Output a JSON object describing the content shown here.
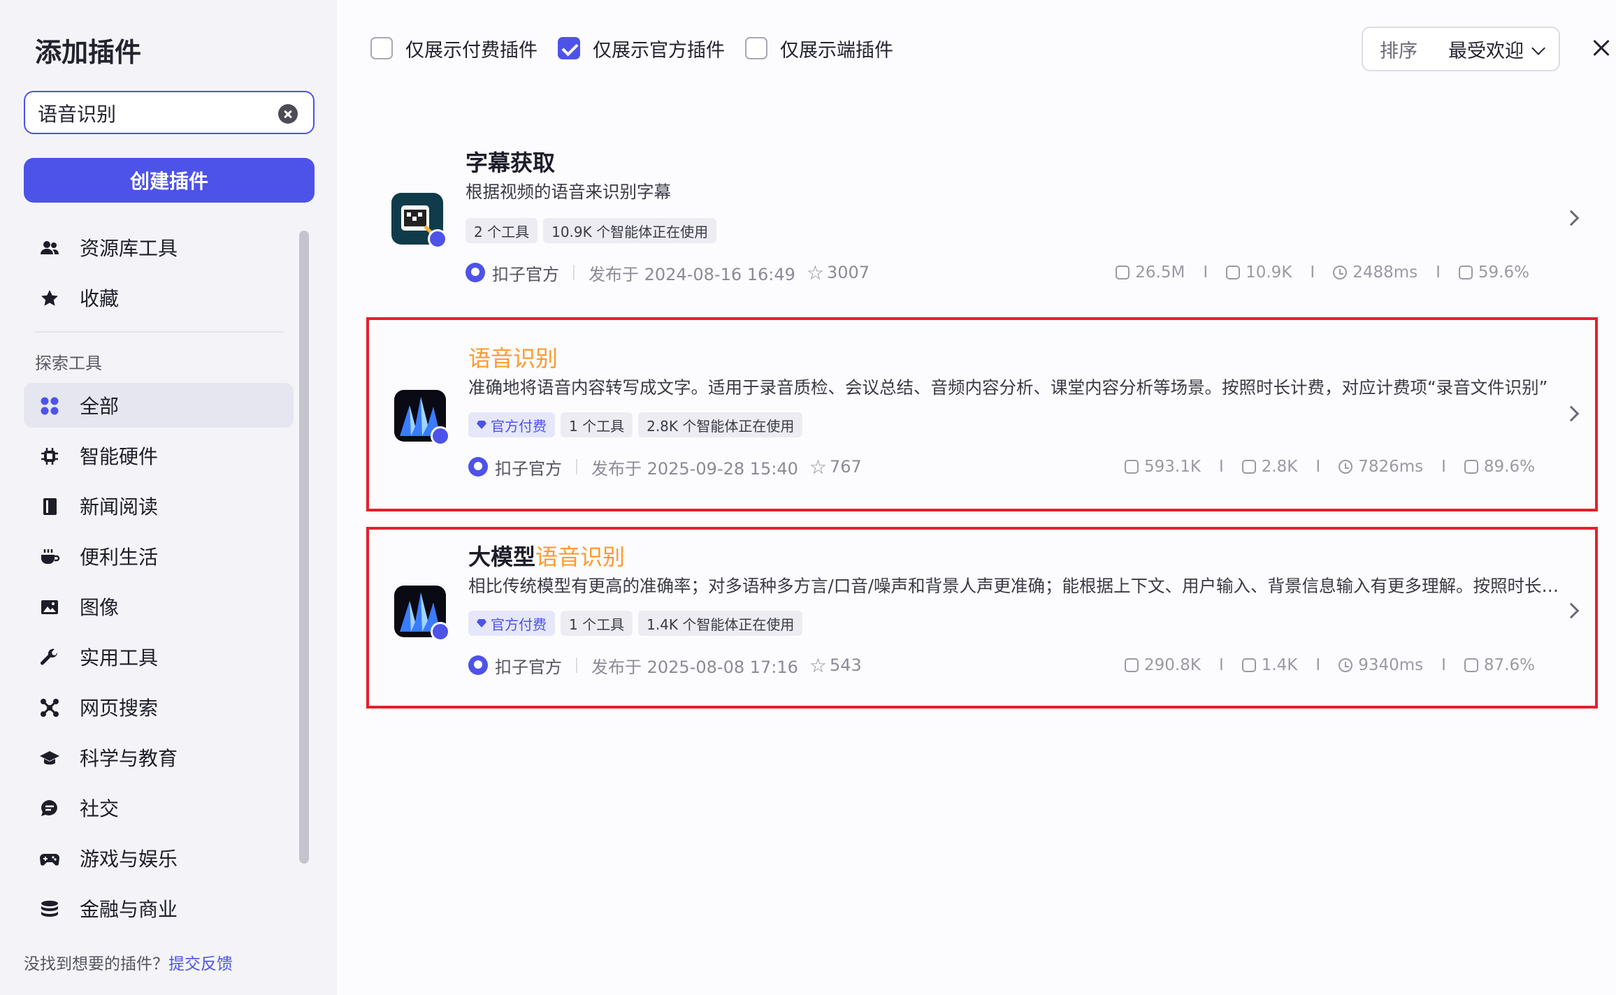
{
  "sidebar": {
    "title": "添加插件",
    "search": {
      "value": "语音识别",
      "placeholder": ""
    },
    "create_button": "创建插件",
    "top_items": [
      {
        "label": "资源库工具",
        "icon": "users-icon"
      },
      {
        "label": "收藏",
        "icon": "star-icon"
      }
    ],
    "section_label": "探索工具",
    "categories": [
      {
        "label": "全部",
        "icon": "grid-icon",
        "active": true
      },
      {
        "label": "智能硬件",
        "icon": "chip-icon"
      },
      {
        "label": "新闻阅读",
        "icon": "book-icon"
      },
      {
        "label": "便利生活",
        "icon": "cup-icon"
      },
      {
        "label": "图像",
        "icon": "image-icon"
      },
      {
        "label": "实用工具",
        "icon": "wrench-icon"
      },
      {
        "label": "网页搜索",
        "icon": "network-icon"
      },
      {
        "label": "科学与教育",
        "icon": "graduation-cap-icon"
      },
      {
        "label": "社交",
        "icon": "chat-icon"
      },
      {
        "label": "游戏与娱乐",
        "icon": "gamepad-icon"
      },
      {
        "label": "金融与商业",
        "icon": "coins-icon"
      }
    ],
    "footer": {
      "text": "没找到想要的插件？",
      "link": "提交反馈"
    }
  },
  "filters": [
    {
      "label": "仅展示付费插件",
      "checked": false
    },
    {
      "label": "仅展示官方插件",
      "checked": true
    },
    {
      "label": "仅展示端插件",
      "checked": false
    }
  ],
  "sort": {
    "label": "排序",
    "value": "最受欢迎"
  },
  "plugins": [
    {
      "title": "字幕获取",
      "title_highlight": "",
      "description": "根据视频的语音来识别字幕",
      "tags": [
        "2 个工具",
        "10.9K 个智能体正在使用"
      ],
      "official_paid": false,
      "author": "扣子官方",
      "published": "发布于 2024-08-16 16:49",
      "stars": "3007",
      "stats": [
        "26.5M",
        "10.9K",
        "2488ms",
        "59.6%"
      ],
      "outlined": false
    },
    {
      "title": "",
      "title_highlight": "语音识别",
      "description": "准确地将语音内容转写成文字。适用于录音质检、会议总结、音频内容分析、课堂内容分析等场景。按照时长计费，对应计费项“录音文件识别”",
      "tags": [
        "1 个工具",
        "2.8K 个智能体正在使用"
      ],
      "official_paid": true,
      "official_label": "官方付费",
      "author": "扣子官方",
      "published": "发布于 2025-09-28 15:40",
      "stars": "767",
      "stats": [
        "593.1K",
        "2.8K",
        "7826ms",
        "89.6%"
      ],
      "outlined": true
    },
    {
      "title": "大模型",
      "title_highlight": "语音识别",
      "description": "相比传统模型有更高的准确率；对多语种多方言/口音/噪声和背景人声更准确；能根据上下文、用户输入、背景信息输入有更多理解。按照时长计费",
      "tags": [
        "1 个工具",
        "1.4K 个智能体正在使用"
      ],
      "official_paid": true,
      "official_label": "官方付费",
      "author": "扣子官方",
      "published": "发布于 2025-08-08 17:16",
      "stars": "543",
      "stats": [
        "290.8K",
        "1.4K",
        "9340ms",
        "87.6%"
      ],
      "outlined": true
    }
  ],
  "colors": {
    "accent": "#4d53e8",
    "highlight": "#ff9a2e",
    "outline": "#e5202a"
  }
}
